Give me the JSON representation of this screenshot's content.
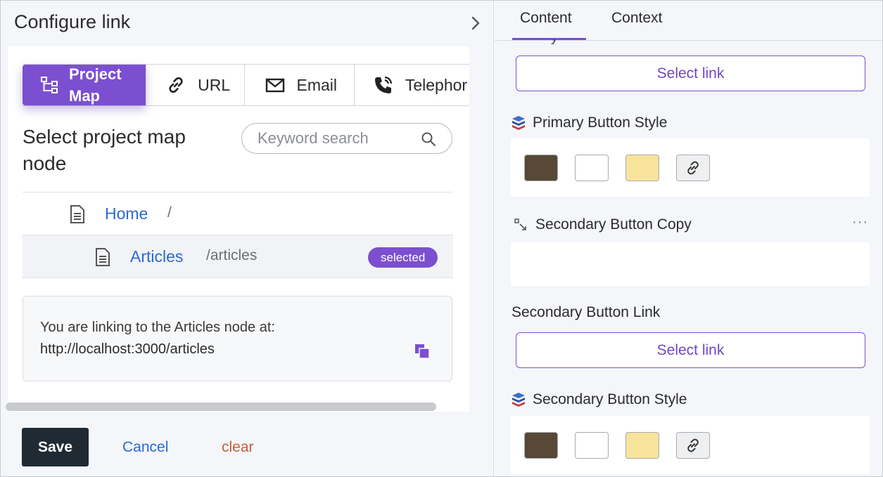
{
  "dialog": {
    "title": "Configure link",
    "tabs": [
      {
        "label_line1": "Project",
        "label_line2": "Map",
        "icon": "sitemap-icon",
        "active": true
      },
      {
        "label": "URL",
        "icon": "link-icon"
      },
      {
        "label": "Email",
        "icon": "mail-icon"
      },
      {
        "label": "Telephor",
        "icon": "phone-icon"
      }
    ],
    "section_title": "Select project map node",
    "search": {
      "placeholder": "Keyword search",
      "value": ""
    },
    "tree": [
      {
        "name": "Home",
        "path": "/",
        "icon": "document-icon"
      },
      {
        "name": "Articles",
        "path": "/articles",
        "icon": "document-icon",
        "badge": "selected"
      }
    ],
    "info": {
      "message": "You are linking to the Articles node at:",
      "url": "http://localhost:3000/articles"
    },
    "buttons": {
      "save": "Save",
      "cancel": "Cancel",
      "clear": "clear"
    }
  },
  "panel": {
    "tabs": [
      {
        "label": "Content",
        "active": true
      },
      {
        "label": "Context"
      }
    ],
    "cut_label": "y",
    "select_link_label": "Select link",
    "primary_style_label": "Primary Button Style",
    "secondary_copy_label": "Secondary Button Copy",
    "secondary_link_label": "Secondary Button Link",
    "secondary_style_label": "Secondary Button Style",
    "more_label": "···",
    "swatches": [
      "#574838",
      "#ffffff",
      "#f7e39c"
    ],
    "colors": {
      "accent": "#7b4fcf",
      "link": "#2a6ad0",
      "clear": "#c2603a",
      "save_bg": "#1f2a33"
    }
  }
}
